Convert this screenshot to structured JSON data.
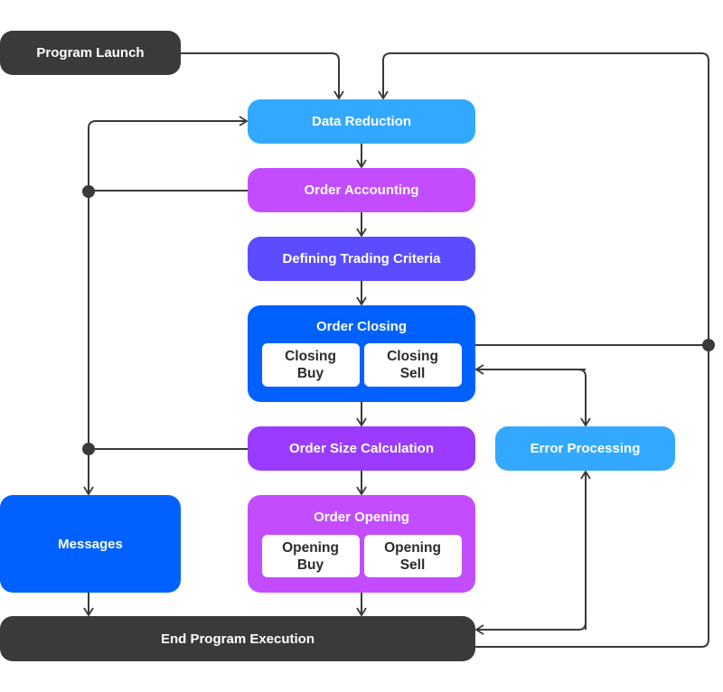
{
  "diagram": {
    "nodes": {
      "program_launch": {
        "label": "Program Launch",
        "color": "#3a3a3a"
      },
      "data_reduction": {
        "label": "Data Reduction",
        "color": "#33a8ff"
      },
      "order_accounting": {
        "label": "Order Accounting",
        "color": "#c44cff"
      },
      "defining_trading_criteria": {
        "label": "Defining Trading Criteria",
        "color": "#5b4cff"
      },
      "order_closing": {
        "label": "Order Closing",
        "color": "#0061ff",
        "children": [
          {
            "label": "Closing\nBuy"
          },
          {
            "label": "Closing\nSell"
          }
        ]
      },
      "order_size_calculation": {
        "label": "Order Size Calculation",
        "color": "#9b3bff"
      },
      "error_processing": {
        "label": "Error Processing",
        "color": "#33a8ff"
      },
      "messages": {
        "label": "Messages",
        "color": "#0061ff"
      },
      "order_opening": {
        "label": "Order Opening",
        "color": "#c44cff",
        "children": [
          {
            "label": "Opening\nBuy"
          },
          {
            "label": "Opening\nSell"
          }
        ]
      },
      "end_program_execution": {
        "label": "End Program Execution",
        "color": "#3a3a3a"
      }
    },
    "edges": [
      {
        "from": "program_launch",
        "to": "data_reduction"
      },
      {
        "from": "data_reduction",
        "to": "order_accounting"
      },
      {
        "from": "order_accounting",
        "to": "defining_trading_criteria"
      },
      {
        "from": "defining_trading_criteria",
        "to": "order_closing"
      },
      {
        "from": "order_closing",
        "to": "order_size_calculation"
      },
      {
        "from": "order_size_calculation",
        "to": "order_opening"
      },
      {
        "from": "order_opening",
        "to": "end_program_execution"
      },
      {
        "from": "messages",
        "to": "end_program_execution"
      },
      {
        "from": "order_accounting",
        "to": "data_reduction",
        "via": "left-bus"
      },
      {
        "from": "order_accounting",
        "to": "messages",
        "via": "left-bus"
      },
      {
        "from": "order_size_calculation",
        "to": "messages",
        "via": "left-bus"
      },
      {
        "from": "order_closing",
        "to": "data_reduction",
        "via": "right-bus"
      },
      {
        "from": "end_program_execution",
        "to": "data_reduction",
        "via": "right-bus"
      },
      {
        "from": "order_closing",
        "to": "error_processing",
        "bidirectional": true
      },
      {
        "from": "end_program_execution",
        "to": "error_processing",
        "bidirectional": true
      }
    ],
    "line_color": "#3a3a3a"
  }
}
